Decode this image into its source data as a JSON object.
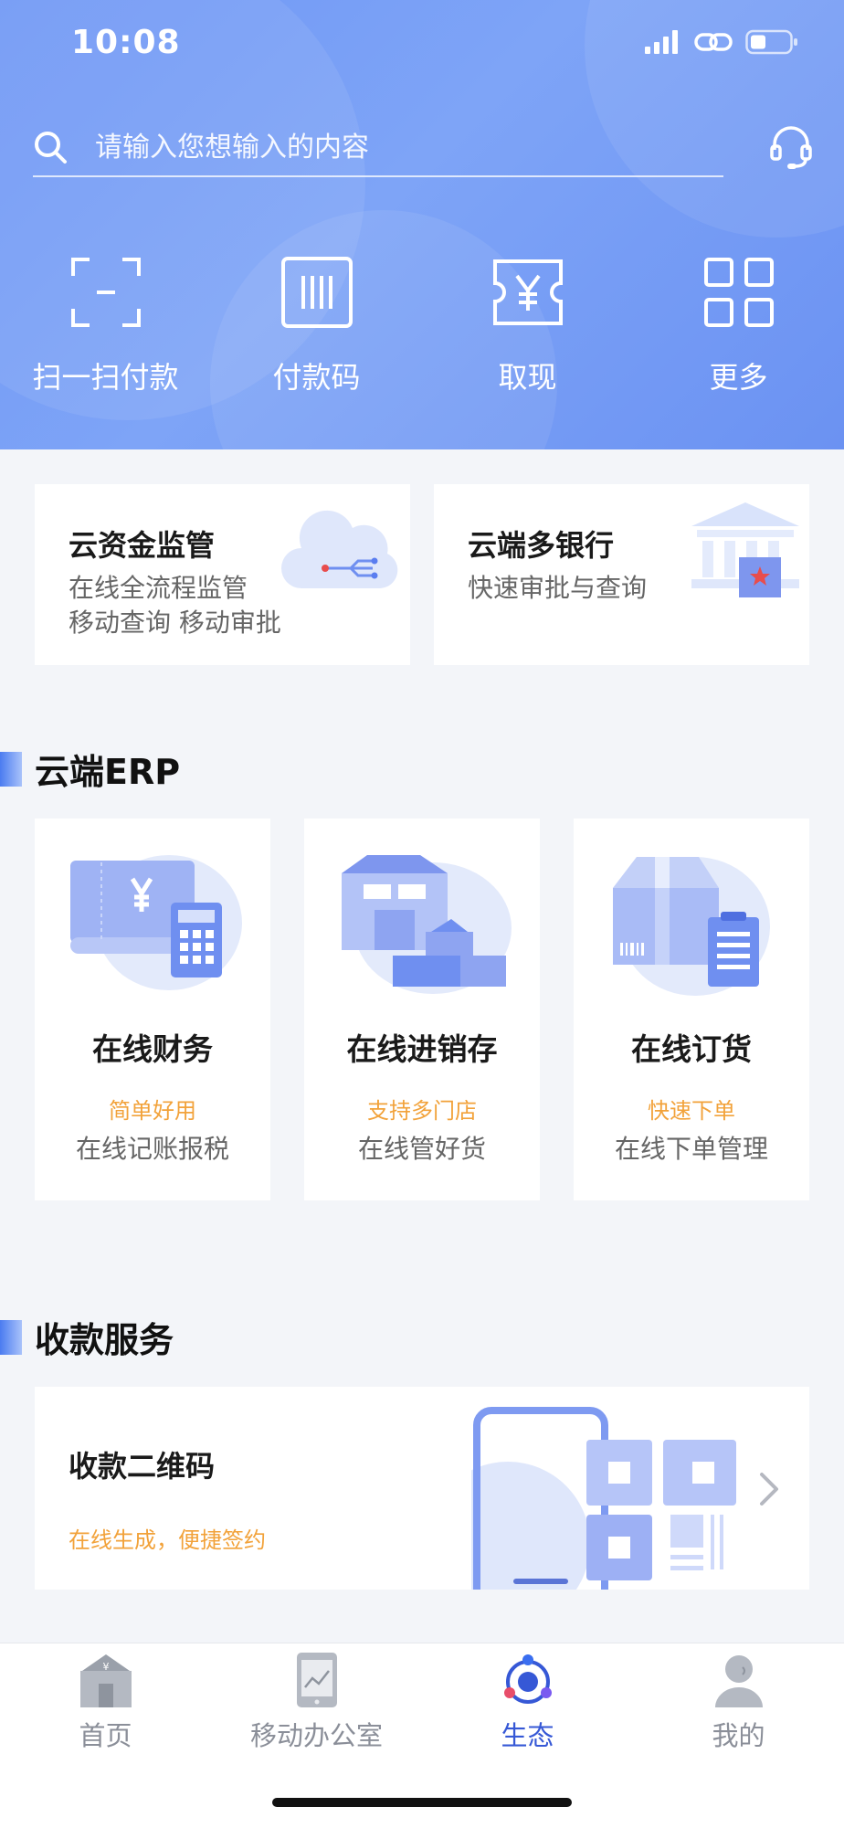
{
  "status": {
    "time": "10:08"
  },
  "search": {
    "placeholder": "请输入您想输入的内容"
  },
  "quick_actions": [
    {
      "label": "扫一扫付款",
      "icon": "scan-icon"
    },
    {
      "label": "付款码",
      "icon": "barcode-icon"
    },
    {
      "label": "取现",
      "icon": "cash-ticket-icon"
    },
    {
      "label": "更多",
      "icon": "grid-icon"
    }
  ],
  "promo_cards": [
    {
      "title": "云资金监管",
      "lines": [
        "在线全流程监管",
        "移动查询 移动审批"
      ]
    },
    {
      "title": "云端多银行",
      "lines": [
        "快速审批与查询"
      ]
    }
  ],
  "erp": {
    "section_title": "云端ERP",
    "items": [
      {
        "title": "在线财务",
        "tag": "简单好用",
        "desc": "在线记账报税"
      },
      {
        "title": "在线进销存",
        "tag": "支持多门店",
        "desc": "在线管好货"
      },
      {
        "title": "在线订货",
        "tag": "快速下单",
        "desc": "在线下单管理"
      }
    ]
  },
  "collection": {
    "section_title": "收款服务",
    "card_title": "收款二维码",
    "card_desc": "在线生成，便捷签约"
  },
  "tabbar": [
    {
      "label": "首页",
      "icon": "bank-building-icon",
      "active": false
    },
    {
      "label": "移动办公室",
      "icon": "tablet-chart-icon",
      "active": false
    },
    {
      "label": "生态",
      "icon": "ecosystem-icon",
      "active": true
    },
    {
      "label": "我的",
      "icon": "user-icon",
      "active": false
    }
  ],
  "colors": {
    "hero_blue": "#6f97f5",
    "accent": "#3658d6",
    "tag_orange": "#f2a23a"
  }
}
